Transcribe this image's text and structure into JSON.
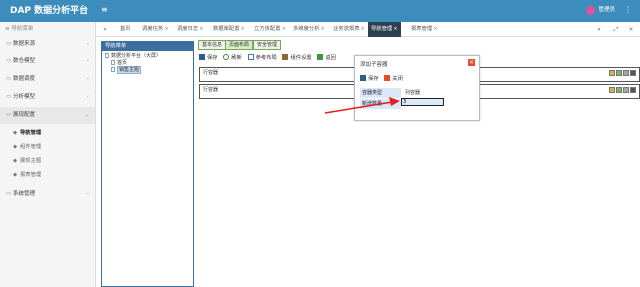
{
  "app": {
    "title": "DAP 数据分析平台",
    "user": "管理员",
    "accent": "#3c8dbc"
  },
  "sidebar": {
    "header": "导航菜单",
    "items": [
      {
        "label": "数据来源"
      },
      {
        "label": "数仓模型"
      },
      {
        "label": "数据调度"
      },
      {
        "label": "分析模型"
      },
      {
        "label": "展现配置"
      }
    ],
    "subitems": [
      {
        "label": "导航管理"
      },
      {
        "label": "组件管理"
      },
      {
        "label": "展现主题"
      },
      {
        "label": "报表管理"
      }
    ],
    "system": {
      "label": "系统管理"
    }
  },
  "tabs": [
    {
      "label": "首页"
    },
    {
      "label": "调度任务"
    },
    {
      "label": "调度日志"
    },
    {
      "label": "数据库配置"
    },
    {
      "label": "立方体配置"
    },
    {
      "label": "多维度分析"
    },
    {
      "label": "业务流报表"
    },
    {
      "label": "导航管理"
    },
    {
      "label": "报表管理"
    }
  ],
  "navpanel": {
    "title": "导航菜单",
    "tree": [
      {
        "label": "数据分析平台（大屏）"
      },
      {
        "label": "首页"
      },
      {
        "label": "销售主题"
      }
    ]
  },
  "right": {
    "tabs": [
      {
        "label": "基本信息"
      },
      {
        "label": "页面布局"
      },
      {
        "label": "安全管理"
      }
    ],
    "toolbar": [
      {
        "label": "保存",
        "icon": "save-icon"
      },
      {
        "label": "刷新",
        "icon": "refresh-icon"
      },
      {
        "label": "参考布局",
        "icon": "layout-icon"
      },
      {
        "label": "组件设置",
        "icon": "wrench-icon"
      },
      {
        "label": "返回",
        "icon": "back-icon"
      }
    ],
    "containers": [
      {
        "label": "行容器"
      },
      {
        "label": "行容器"
      }
    ]
  },
  "dialog": {
    "title": "添加子容器",
    "save": "保存",
    "close": "关闭",
    "type_label": "容器类型",
    "type_value": "列容器",
    "count_label": "新增数量",
    "count_value": "3"
  }
}
